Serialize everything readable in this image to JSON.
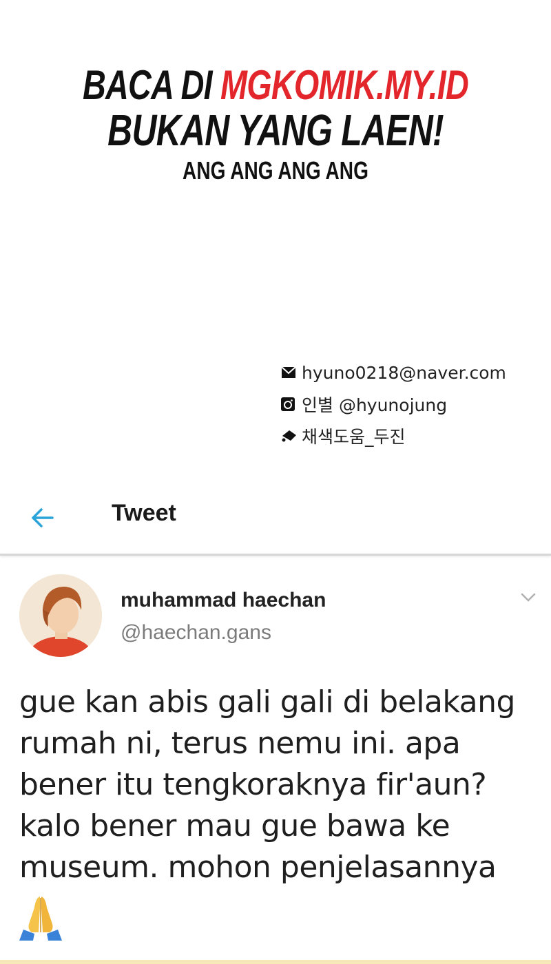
{
  "watermark": {
    "line1_prefix": "BACA DI ",
    "line1_site": "MGKOMIK.MY.ID",
    "line2": "BUKAN YANG LAEN!",
    "line3": "ANG ANG ANG ANG",
    "site_color": "#e3262b"
  },
  "credits": {
    "email": "hyuno0218@naver.com",
    "instagram": "인별 @hyunojung",
    "coloring": "채색도움_두진",
    "icons": [
      "envelope-icon",
      "instagram-icon",
      "paint-icon"
    ]
  },
  "header": {
    "title": "Tweet",
    "back_icon": "back-arrow-icon",
    "accent": "#2aa3d8"
  },
  "tweet": {
    "display_name": "muhammad haechan",
    "username": "@haechan.gans",
    "lines": [
      "gue kan abis gali gali di belakang",
      "rumah ni, terus nemu ini. apa",
      "bener itu tengkoraknya fir'aun?",
      "kalo bener mau gue bawa ke",
      "museum. mohon penjelasannya"
    ],
    "emoji": "folded-hands-emoji",
    "menu_icon": "chevron-down-icon"
  }
}
